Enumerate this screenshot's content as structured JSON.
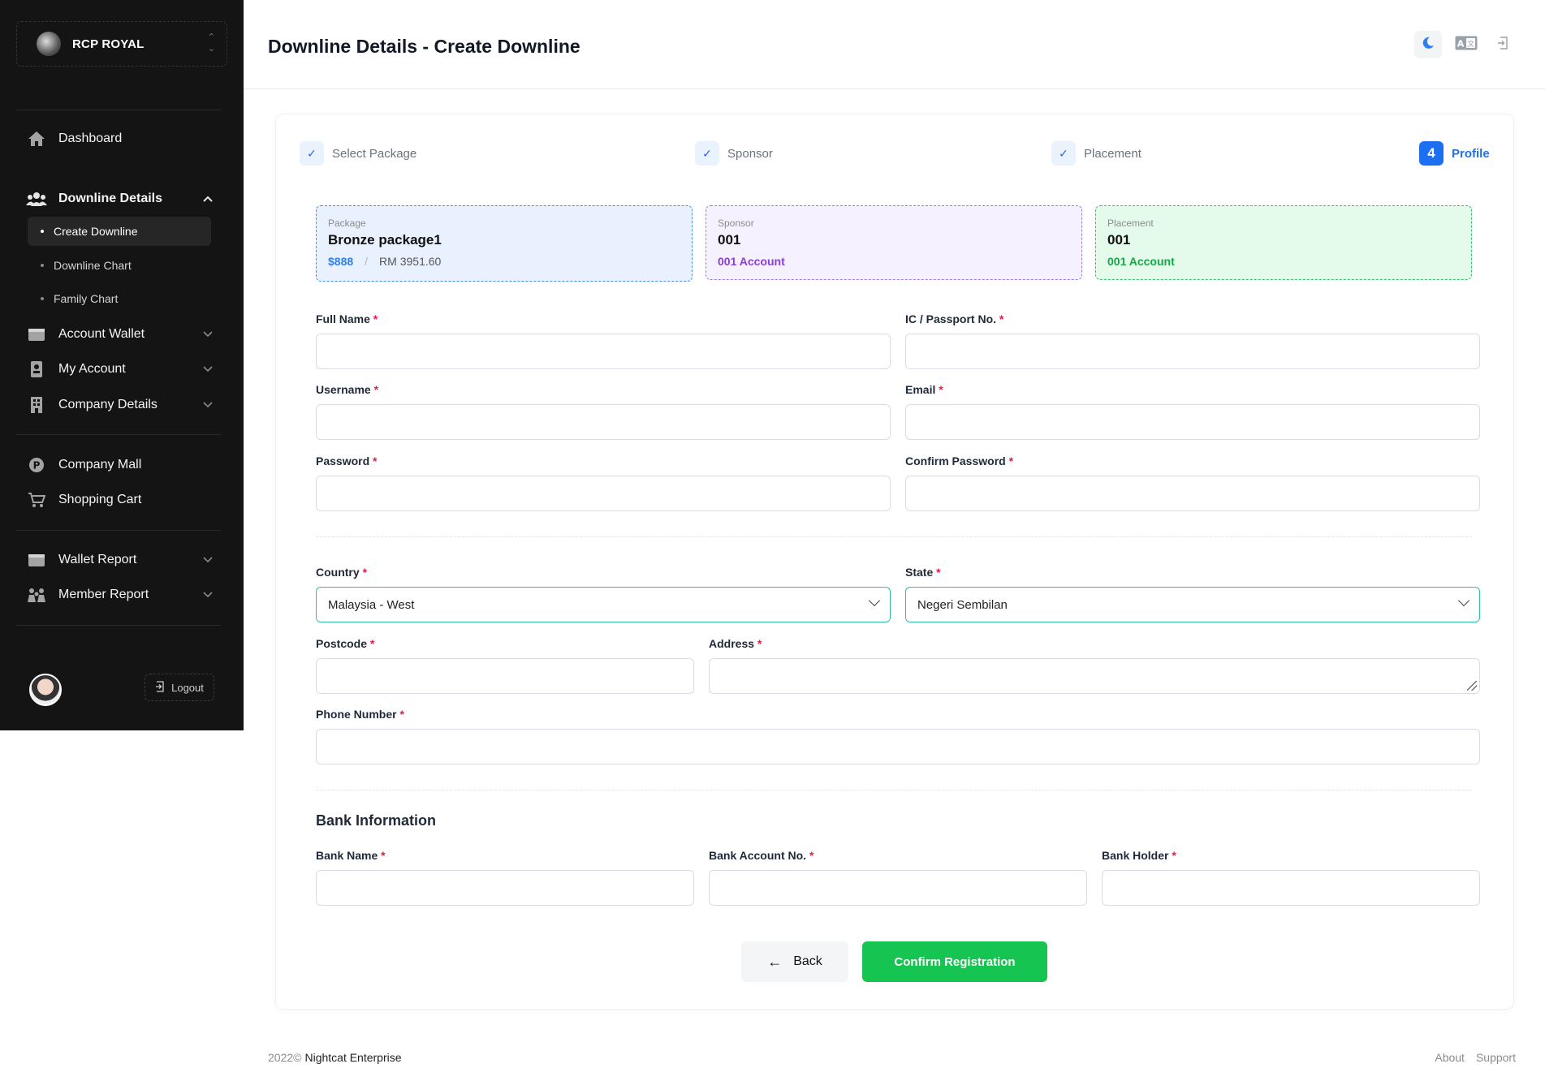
{
  "brand": {
    "name": "RCP ROYAL",
    "sort_up": "⌃",
    "sort_down": "⌄"
  },
  "sidebar": {
    "items": [
      {
        "label": "Dashboard",
        "icon": "home-icon"
      },
      {
        "label": "Downline Details",
        "icon": "users-icon",
        "expanded": true
      },
      {
        "label": "Account Wallet",
        "icon": "wallet-icon"
      },
      {
        "label": "My Account",
        "icon": "badge-icon"
      },
      {
        "label": "Company Details",
        "icon": "building-icon"
      },
      {
        "label": "Company Mall",
        "icon": "parking-icon"
      },
      {
        "label": "Shopping Cart",
        "icon": "cart-icon"
      },
      {
        "label": "Wallet Report",
        "icon": "wallet-icon"
      },
      {
        "label": "Member Report",
        "icon": "group-icon"
      }
    ],
    "sub_items": [
      {
        "label": "Create Downline",
        "active": true
      },
      {
        "label": "Downline Chart"
      },
      {
        "label": "Family Chart"
      }
    ],
    "logout_label": "Logout"
  },
  "header": {
    "title": "Downline Details - Create Downline",
    "lang_label": "A文"
  },
  "steps": [
    {
      "label": "Select Package",
      "mark": "✓"
    },
    {
      "label": "Sponsor",
      "mark": "✓"
    },
    {
      "label": "Placement",
      "mark": "✓"
    },
    {
      "label": "Profile",
      "mark": "4",
      "active": true
    }
  ],
  "summary": {
    "package": {
      "label": "Package",
      "name": "Bronze package1",
      "price": "$888",
      "sep": "/",
      "rm": "RM 3951.60"
    },
    "sponsor": {
      "label": "Sponsor",
      "code": "001",
      "account": "001 Account"
    },
    "placement": {
      "label": "Placement",
      "code": "001",
      "account": "001 Account"
    }
  },
  "form": {
    "required_mark": "*",
    "full_name": {
      "label": "Full Name",
      "value": ""
    },
    "ic": {
      "label": "IC / Passport No.",
      "value": ""
    },
    "username": {
      "label": "Username",
      "value": ""
    },
    "email": {
      "label": "Email",
      "value": ""
    },
    "password": {
      "label": "Password",
      "value": ""
    },
    "confirm_password": {
      "label": "Confirm Password",
      "value": ""
    },
    "country": {
      "label": "Country",
      "value": "Malaysia - West"
    },
    "state": {
      "label": "State",
      "value": "Negeri Sembilan"
    },
    "postcode": {
      "label": "Postcode",
      "value": ""
    },
    "address": {
      "label": "Address",
      "value": ""
    },
    "phone": {
      "label": "Phone Number",
      "value": ""
    },
    "bank_section_title": "Bank Information",
    "bank_name": {
      "label": "Bank Name",
      "value": ""
    },
    "bank_account": {
      "label": "Bank Account No.",
      "value": ""
    },
    "bank_holder": {
      "label": "Bank Holder",
      "value": ""
    }
  },
  "buttons": {
    "back": "Back",
    "back_arrow": "←",
    "confirm": "Confirm Registration"
  },
  "footer": {
    "year": "2022©",
    "company": "Nightcat Enterprise",
    "about": "About",
    "support": "Support"
  },
  "colors": {
    "sidebar_bg": "#141414",
    "accent_blue": "#1d6ff2",
    "confirm_green": "#16c451",
    "select_border": "#2bbfa4"
  }
}
